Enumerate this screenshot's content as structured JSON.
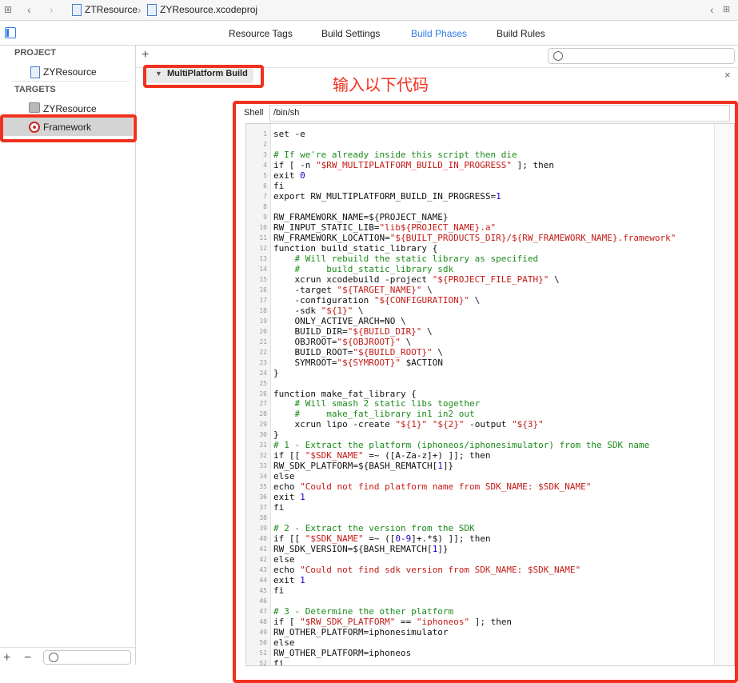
{
  "jumpbar": {
    "crumbs": [
      "ZTResource",
      "ZYResource.xcodeproj"
    ]
  },
  "tabs": [
    {
      "label": "Resource Tags",
      "active": false
    },
    {
      "label": "Build Settings",
      "active": false
    },
    {
      "label": "Build Phases",
      "active": true
    },
    {
      "label": "Build Rules",
      "active": false
    }
  ],
  "sidebar": {
    "project_header": "PROJECT",
    "project_item": "ZYResource",
    "targets_header": "TARGETS",
    "target_items": [
      "ZYResource",
      "Framework"
    ],
    "add_label": "+",
    "remove_label": "−"
  },
  "main": {
    "add_phase": "+",
    "phase_title": "MultiPlatform Build",
    "annotation": "输入以下代码",
    "close": "×",
    "shell_label": "Shell",
    "shell_value": "/bin/sh"
  },
  "code_lines": [
    "set -e",
    "",
    "# If we're already inside this script then die",
    "if [ -n \"$RW_MULTIPLATFORM_BUILD_IN_PROGRESS\" ]; then",
    "exit 0",
    "fi",
    "export RW_MULTIPLATFORM_BUILD_IN_PROGRESS=1",
    "",
    "RW_FRAMEWORK_NAME=${PROJECT_NAME}",
    "RW_INPUT_STATIC_LIB=\"lib${PROJECT_NAME}.a\"",
    "RW_FRAMEWORK_LOCATION=\"${BUILT_PRODUCTS_DIR}/${RW_FRAMEWORK_NAME}.framework\"",
    "function build_static_library {",
    "    # Will rebuild the static library as specified",
    "    #     build_static_library sdk",
    "    xcrun xcodebuild -project \"${PROJECT_FILE_PATH}\" \\",
    "    -target \"${TARGET_NAME}\" \\",
    "    -configuration \"${CONFIGURATION}\" \\",
    "    -sdk \"${1}\" \\",
    "    ONLY_ACTIVE_ARCH=NO \\",
    "    BUILD_DIR=\"${BUILD_DIR}\" \\",
    "    OBJROOT=\"${OBJROOT}\" \\",
    "    BUILD_ROOT=\"${BUILD_ROOT}\" \\",
    "    SYMROOT=\"${SYMROOT}\" $ACTION",
    "}",
    "",
    "function make_fat_library {",
    "    # Will smash 2 static libs together",
    "    #     make_fat_library in1 in2 out",
    "    xcrun lipo -create \"${1}\" \"${2}\" -output \"${3}\"",
    "}",
    "# 1 - Extract the platform (iphoneos/iphonesimulator) from the SDK name",
    "if [[ \"$SDK_NAME\" =~ ([A-Za-z]+) ]]; then",
    "RW_SDK_PLATFORM=${BASH_REMATCH[1]}",
    "else",
    "echo \"Could not find platform name from SDK_NAME: $SDK_NAME\"",
    "exit 1",
    "fi",
    "",
    "# 2 - Extract the version from the SDK",
    "if [[ \"$SDK_NAME\" =~ ([0-9]+.*$) ]]; then",
    "RW_SDK_VERSION=${BASH_REMATCH[1]}",
    "else",
    "echo \"Could not find sdk version from SDK_NAME: $SDK_NAME\"",
    "exit 1",
    "fi",
    "",
    "# 3 - Determine the other platform",
    "if [ \"$RW_SDK_PLATFORM\" == \"iphoneos\" ]; then",
    "RW_OTHER_PLATFORM=iphonesimulator",
    "else",
    "RW_OTHER_PLATFORM=iphoneos",
    "fi"
  ],
  "colors": {
    "accent": "#2f7ae5",
    "highlight_box": "#f0311e",
    "comment": "#1b8a1b",
    "string": "#c41a16",
    "number": "#1c00cf"
  }
}
